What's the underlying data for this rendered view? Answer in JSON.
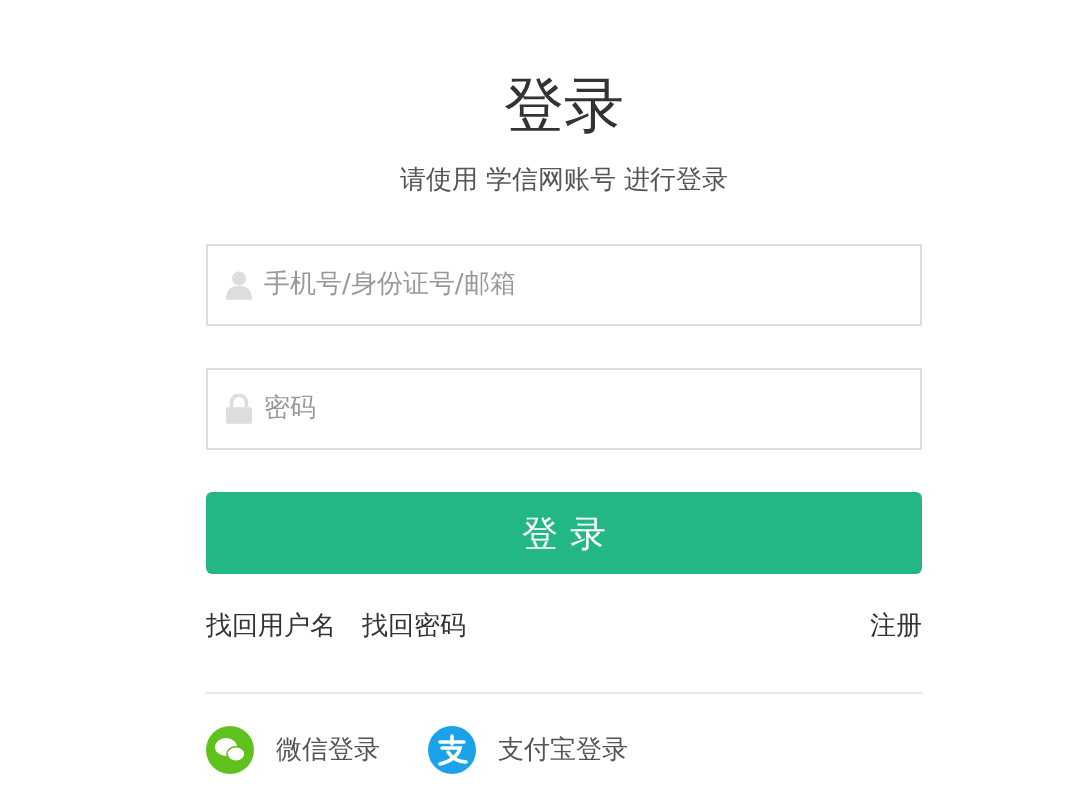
{
  "title": "登录",
  "subtitle": "请使用 学信网账号 进行登录",
  "fields": [
    {
      "kind": "user",
      "placeholder": "手机号/身份证号/邮箱"
    },
    {
      "kind": "password",
      "placeholder": "密码"
    }
  ],
  "submit": "登 录",
  "links_left": [
    "找回用户名",
    "找回密码"
  ],
  "link_right": "注册",
  "social": [
    {
      "kind": "chat",
      "label": "微信登录",
      "color": "#5fc11b"
    },
    {
      "kind": "pay",
      "label": "支付宝登录",
      "color": "#1aa3e8"
    }
  ]
}
